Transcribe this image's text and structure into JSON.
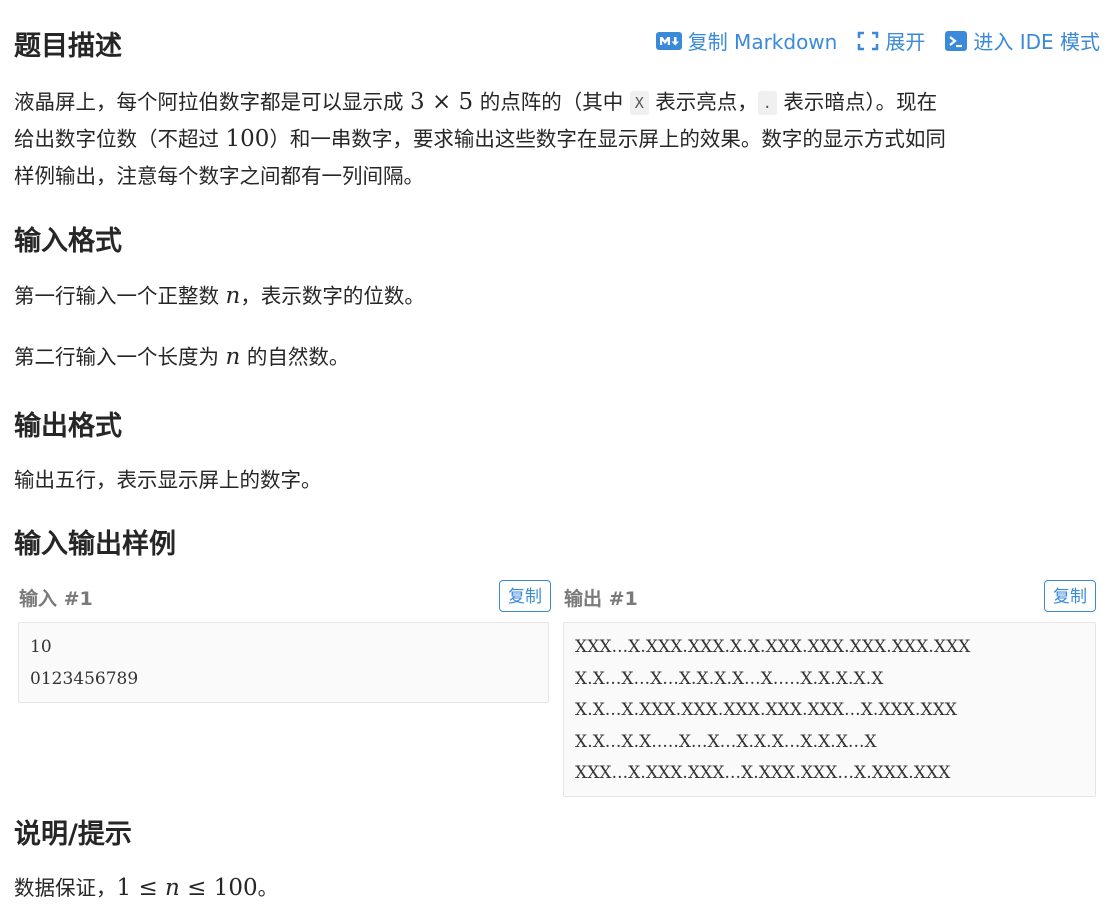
{
  "toolbar": {
    "copy_markdown": "复制 Markdown",
    "expand": "展开",
    "ide_mode": "进入 IDE 模式"
  },
  "description": {
    "title": "题目描述",
    "text_1": "液晶屏上，每个阿拉伯数字都是可以显示成 ",
    "math_1": "3 × 5",
    "text_2": " 的点阵的（其中 ",
    "code_x": "X",
    "text_3": " 表示亮点，",
    "code_dot": ".",
    "text_4": " 表示暗点）。现在",
    "text_5": "给出数字位数（不超过 ",
    "math_2": "100",
    "text_6": "）和一串数字，要求输出这些数字在显示屏上的效果。数字的显示方式如同",
    "text_7": "样例输出，注意每个数字之间都有一列间隔。"
  },
  "input_format": {
    "title": "输入格式",
    "line1_a": "第一行输入一个正整数 ",
    "line1_var": "n",
    "line1_b": "，表示数字的位数。",
    "line2_a": "第二行输入一个长度为 ",
    "line2_var": "n",
    "line2_b": " 的自然数。"
  },
  "output_format": {
    "title": "输出格式",
    "text": "输出五行，表示显示屏上的数字。"
  },
  "samples": {
    "title": "输入输出样例",
    "input_label": "输入 #1",
    "output_label": "输出 #1",
    "copy_label": "复制",
    "input_text": "10\n0123456789",
    "output_text": "XXX...X.XXX.XXX.X.X.XXX.XXX.XXX.XXX.XXX\nX.X...X...X...X.X.X.X...X.....X.X.X.X.X\nX.X...X.XXX.XXX.XXX.XXX.XXX...X.XXX.XXX\nX.X...X.X.....X...X...X.X.X...X.X.X...X\nXXX...X.XXX.XXX...X.XXX.XXX...X.XXX.XXX"
  },
  "hint": {
    "title": "说明/提示",
    "text_a": "数据保证，",
    "math": "1 ≤ ",
    "var": "n",
    "math_b": " ≤ 100",
    "text_b": "。"
  },
  "colors": {
    "accent": "#3a8ad9",
    "text": "#262626",
    "muted": "#7a7a7a",
    "code_bg": "#fafafa"
  }
}
